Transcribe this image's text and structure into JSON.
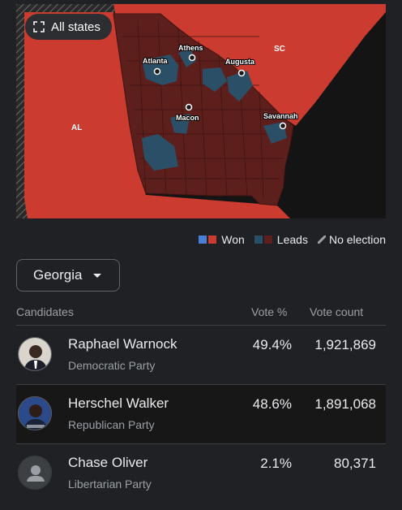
{
  "map": {
    "all_states_label": "All states",
    "labels": {
      "al": "AL",
      "sc": "SC",
      "atlanta": "Atlanta",
      "athens": "Athens",
      "augusta": "Augusta",
      "macon": "Macon",
      "savannah": "Savannah"
    },
    "colors": {
      "republican_won": "#cc3b2f",
      "republican_leads": "#5d1f1c",
      "democrat_won": "#4a7fd6",
      "democrat_leads": "#2b4f67",
      "ocean": "#141414"
    }
  },
  "legend": {
    "won": "Won",
    "leads": "Leads",
    "no_election": "No election"
  },
  "state_select": {
    "value": "Georgia"
  },
  "table": {
    "headers": {
      "candidates": "Candidates",
      "vote_pct": "Vote %",
      "vote_count": "Vote count"
    },
    "rows": [
      {
        "name": "Raphael Warnock",
        "party": "Democratic Party",
        "pct": "49.4%",
        "count": "1,921,869"
      },
      {
        "name": "Herschel Walker",
        "party": "Republican Party",
        "pct": "48.6%",
        "count": "1,891,068"
      },
      {
        "name": "Chase Oliver",
        "party": "Libertarian Party",
        "pct": "2.1%",
        "count": "80,371"
      }
    ]
  }
}
